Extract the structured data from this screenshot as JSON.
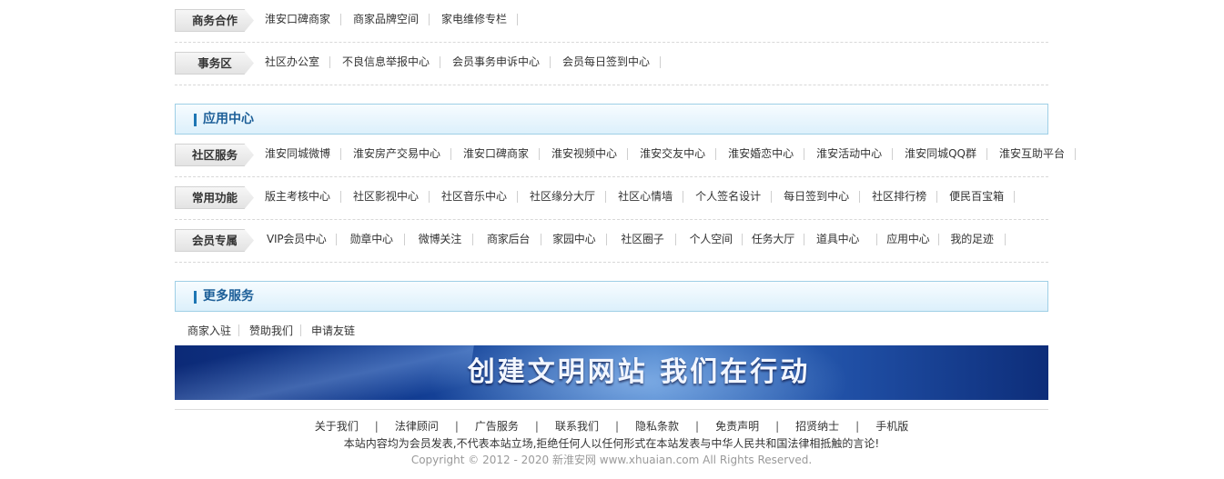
{
  "rows_top": [
    {
      "tag": "商务合作",
      "items": [
        "淮安口碑商家",
        "商家品牌空间",
        "家电维修专栏"
      ]
    },
    {
      "tag": "事务区",
      "items": [
        "社区办公室",
        "不良信息举报中心",
        "会员事务申诉中心",
        "会员每日签到中心"
      ]
    }
  ],
  "app_center": {
    "title": "应用中心",
    "rows": [
      {
        "tag": "社区服务",
        "items": [
          "淮安同城微博",
          "淮安房产交易中心",
          "淮安口碑商家",
          "淮安视频中心",
          "淮安交友中心",
          "淮安婚恋中心",
          "淮安活动中心",
          "淮安同城QQ群",
          "淮安互助平台"
        ]
      },
      {
        "tag": "常用功能",
        "items": [
          "版主考核中心",
          "社区影视中心",
          "社区音乐中心",
          "社区缘分大厅",
          "社区心情墙",
          "个人签名设计",
          "每日签到中心",
          "社区排行榜",
          "便民百宝箱"
        ]
      },
      {
        "tag": "会员专属",
        "items": [
          "VIP会员中心",
          "勋章中心",
          "微博关注",
          "商家后台",
          "家园中心",
          "社区圈子",
          "个人空间",
          "任务大厅",
          "道具中心",
          "应用中心",
          "我的足迹"
        ]
      }
    ]
  },
  "more_services": {
    "title": "更多服务",
    "items": [
      "商家入驻",
      "赞助我们",
      "申请友链"
    ]
  },
  "banner": {
    "text": "创建文明网站 我们在行动"
  },
  "footer": {
    "links": [
      "关于我们",
      "法律顾问",
      "广告服务",
      "联系我们",
      "隐私条款",
      "免责声明",
      "招贤纳士",
      "手机版"
    ],
    "separator": "|",
    "note": "本站内容均为会员发表,不代表本站立场,拒绝任何人以任何形式在本站发表与中华人民共和国法律相抵触的言论!",
    "copyright": "Copyright © 2012 - 2020 新淮安网 www.xhuaian.com All Rights Reserved."
  }
}
